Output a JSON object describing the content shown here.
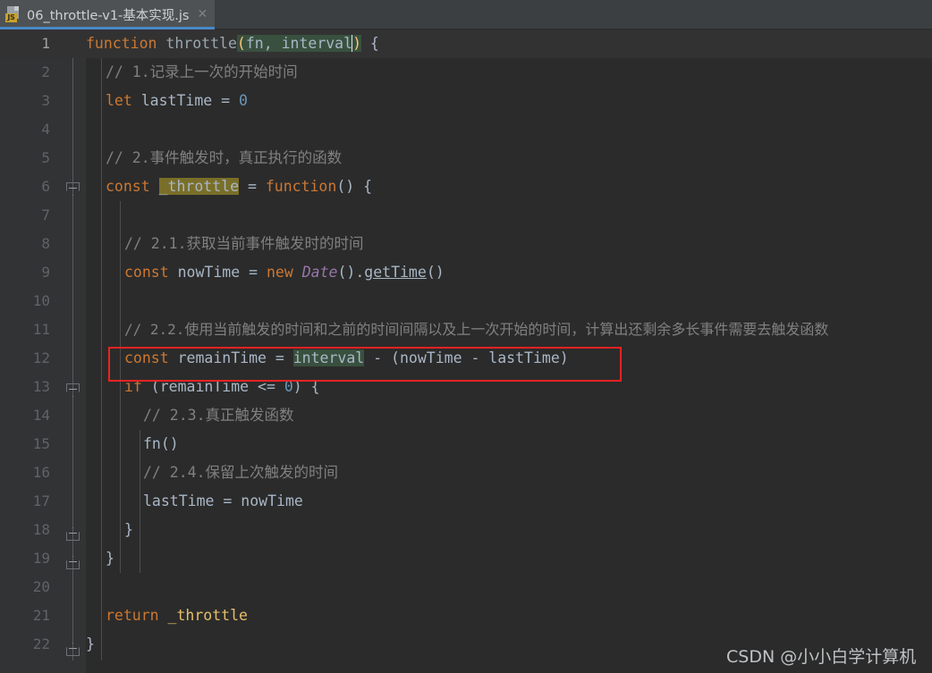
{
  "window": {
    "background_color": "#2b2b2b",
    "tabbar_color": "#3c3f41"
  },
  "tab": {
    "title": "06_throttle-v1-基本实现.js",
    "icon": "js-file-icon",
    "icon_badge": "JS",
    "close_label": "✕",
    "active": true,
    "underline_color": "#4a88c7"
  },
  "editor": {
    "language": "JavaScript",
    "current_line": 1,
    "line_numbers": [
      1,
      2,
      3,
      4,
      5,
      6,
      7,
      8,
      9,
      10,
      11,
      12,
      13,
      14,
      15,
      16,
      17,
      18,
      19,
      20,
      21,
      22
    ],
    "lines": [
      {
        "n": 1,
        "text": "function throttle(fn, interval) {"
      },
      {
        "n": 2,
        "text": "    // 1.记录上一次的开始时间"
      },
      {
        "n": 3,
        "text": "    let lastTime = 0"
      },
      {
        "n": 4,
        "text": ""
      },
      {
        "n": 5,
        "text": "    // 2.事件触发时，真正执行的函数"
      },
      {
        "n": 6,
        "text": "    const _throttle = function() {"
      },
      {
        "n": 7,
        "text": ""
      },
      {
        "n": 8,
        "text": "        // 2.1.获取当前事件触发时的时间"
      },
      {
        "n": 9,
        "text": "        const nowTime = new Date().getTime()"
      },
      {
        "n": 10,
        "text": ""
      },
      {
        "n": 11,
        "text": "        // 2.2.使用当前触发的时间和之前的时间间隔以及上一次开始的时间，计算出还剩余多长事件需要去触发函数"
      },
      {
        "n": 12,
        "text": "        const remainTime = interval - (nowTime - lastTime)"
      },
      {
        "n": 13,
        "text": "        if (remainTime <= 0) {"
      },
      {
        "n": 14,
        "text": "            // 2.3.真正触发函数"
      },
      {
        "n": 15,
        "text": "            fn()"
      },
      {
        "n": 16,
        "text": "            // 2.4.保留上次触发的时间"
      },
      {
        "n": 17,
        "text": "            lastTime = nowTime"
      },
      {
        "n": 18,
        "text": "        }"
      },
      {
        "n": 19,
        "text": "    }"
      },
      {
        "n": 20,
        "text": ""
      },
      {
        "n": 21,
        "text": "    return _throttle"
      },
      {
        "n": 22,
        "text": "}"
      }
    ],
    "tokens": {
      "l1": {
        "kw": "function",
        "name": " throttle",
        "lparen": "(",
        "p1": "fn, ",
        "p2": "interval",
        "rparen": ")",
        "tail": " {"
      },
      "l2": {
        "comment": "// 1.记录上一次的开始时间"
      },
      "l3": {
        "kw": "let",
        "rest": " lastTime = ",
        "num": "0"
      },
      "l5": {
        "comment": "// 2.事件触发时，真正执行的函数"
      },
      "l6": {
        "kw": "const",
        "sp": " ",
        "name": "_throttle",
        "eq": " = ",
        "kw2": "function",
        "tail": "() {"
      },
      "l8": {
        "comment": "// 2.1.获取当前事件触发时的时间"
      },
      "l9": {
        "kw": "const",
        "rest": " nowTime = ",
        "kw2": "new",
        "sp": " ",
        "cls": "Date",
        "paren": "().",
        "meth": "getTime",
        "tail": "()"
      },
      "l11": {
        "comment": "// 2.2.使用当前触发的时间和之前的时间间隔以及上一次开始的时间，计算出还剩余多长事件需要去触发函数"
      },
      "l12": {
        "kw": "const",
        "rest": " remainTime = ",
        "hl": "interval",
        "tail": " - (nowTime - lastTime)"
      },
      "l13": {
        "kw": "if",
        "rest": " (remainTime <= ",
        "num": "0",
        "tail": ") {"
      },
      "l14": {
        "comment": "// 2.3.真正触发函数"
      },
      "l15": {
        "text": "fn()"
      },
      "l16": {
        "comment": "// 2.4.保留上次触发的时间"
      },
      "l17": {
        "text": "lastTime = nowTime"
      },
      "l18": {
        "text": "}"
      },
      "l19": {
        "text": "}"
      },
      "l21": {
        "kw": "return",
        "sp": " ",
        "name": "_throttle"
      },
      "l22": {
        "text": "}"
      }
    },
    "highlights": {
      "selection_color": "#39503f",
      "identifier_highlight_color": "#7a6f29",
      "current_line_color": "#323232"
    }
  },
  "annotation": {
    "type": "red-rectangle",
    "color": "#ee2222",
    "target_line": 12
  },
  "watermark": {
    "text": "CSDN @小小白学计算机"
  }
}
